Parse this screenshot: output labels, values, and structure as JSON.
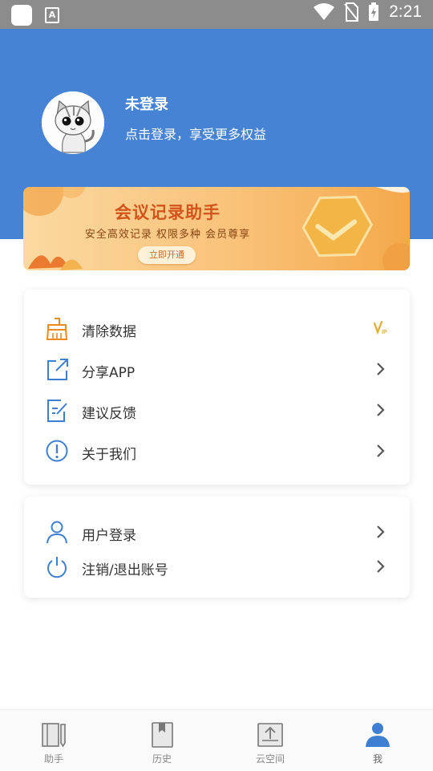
{
  "status_bar": {
    "time": "2:21"
  },
  "profile": {
    "name": "未登录",
    "subtitle": "点击登录，享受更多权益"
  },
  "banner": {
    "title": "会议记录助手",
    "subtitle": "安全高效记录  权限多种  会员尊享",
    "button": "立即开通"
  },
  "menu1": [
    {
      "label": "清除数据",
      "badge": "VIP"
    },
    {
      "label": "分享APP"
    },
    {
      "label": "建议反馈"
    },
    {
      "label": "关于我们"
    }
  ],
  "menu2": [
    {
      "label": "用户登录"
    },
    {
      "label": "注销/退出账号"
    }
  ],
  "tabs": [
    {
      "label": "助手"
    },
    {
      "label": "历史"
    },
    {
      "label": "云空间"
    },
    {
      "label": "我"
    }
  ],
  "colors": {
    "header": "#4683d5",
    "icon_blue": "#3e7fd2",
    "icon_orange": "#f08a1f",
    "vip_gold": "#e2b13c"
  }
}
